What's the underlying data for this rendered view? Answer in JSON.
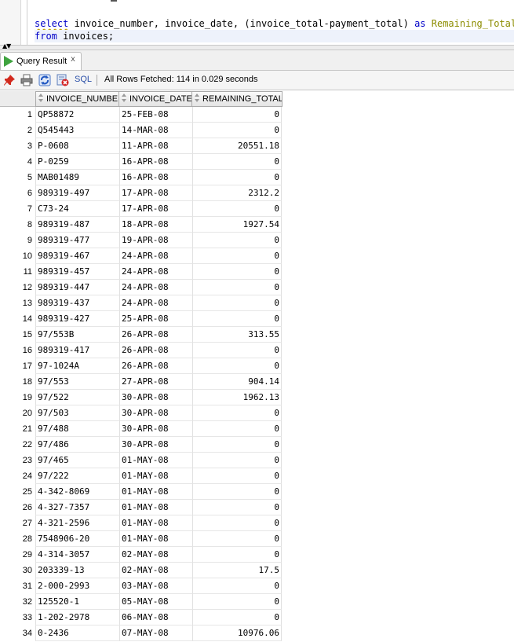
{
  "editor": {
    "line1": {
      "kw_select": "select",
      "columns": " invoice_number, invoice_date, (invoice_total-payment_total) ",
      "kw_as": "as",
      "alias": " Remaining_Total"
    },
    "line2": {
      "kw_from": "from",
      "table": " invoices;"
    }
  },
  "result_tab": {
    "label": "Query Result",
    "close": "x"
  },
  "toolbar": {
    "icons": [
      "pin-icon",
      "print-icon",
      "refresh-icon",
      "cancel-icon"
    ],
    "sql_label": "SQL",
    "status": "All Rows Fetched: 114 in 0.029 seconds"
  },
  "grid": {
    "columns": [
      "INVOICE_NUMBER",
      "INVOICE_DATE",
      "REMAINING_TOTAL"
    ],
    "rows": [
      {
        "n": "1",
        "invoice_number": "QP58872",
        "invoice_date": "25-FEB-08",
        "remaining_total": "0"
      },
      {
        "n": "2",
        "invoice_number": "Q545443",
        "invoice_date": "14-MAR-08",
        "remaining_total": "0"
      },
      {
        "n": "3",
        "invoice_number": "P-0608",
        "invoice_date": "11-APR-08",
        "remaining_total": "20551.18"
      },
      {
        "n": "4",
        "invoice_number": "P-0259",
        "invoice_date": "16-APR-08",
        "remaining_total": "0"
      },
      {
        "n": "5",
        "invoice_number": "MAB01489",
        "invoice_date": "16-APR-08",
        "remaining_total": "0"
      },
      {
        "n": "6",
        "invoice_number": "989319-497",
        "invoice_date": "17-APR-08",
        "remaining_total": "2312.2"
      },
      {
        "n": "7",
        "invoice_number": "C73-24",
        "invoice_date": "17-APR-08",
        "remaining_total": "0"
      },
      {
        "n": "8",
        "invoice_number": "989319-487",
        "invoice_date": "18-APR-08",
        "remaining_total": "1927.54"
      },
      {
        "n": "9",
        "invoice_number": "989319-477",
        "invoice_date": "19-APR-08",
        "remaining_total": "0"
      },
      {
        "n": "10",
        "invoice_number": "989319-467",
        "invoice_date": "24-APR-08",
        "remaining_total": "0"
      },
      {
        "n": "11",
        "invoice_number": "989319-457",
        "invoice_date": "24-APR-08",
        "remaining_total": "0"
      },
      {
        "n": "12",
        "invoice_number": "989319-447",
        "invoice_date": "24-APR-08",
        "remaining_total": "0"
      },
      {
        "n": "13",
        "invoice_number": "989319-437",
        "invoice_date": "24-APR-08",
        "remaining_total": "0"
      },
      {
        "n": "14",
        "invoice_number": "989319-427",
        "invoice_date": "25-APR-08",
        "remaining_total": "0"
      },
      {
        "n": "15",
        "invoice_number": "97/553B",
        "invoice_date": "26-APR-08",
        "remaining_total": "313.55"
      },
      {
        "n": "16",
        "invoice_number": "989319-417",
        "invoice_date": "26-APR-08",
        "remaining_total": "0"
      },
      {
        "n": "17",
        "invoice_number": "97-1024A",
        "invoice_date": "26-APR-08",
        "remaining_total": "0"
      },
      {
        "n": "18",
        "invoice_number": "97/553",
        "invoice_date": "27-APR-08",
        "remaining_total": "904.14"
      },
      {
        "n": "19",
        "invoice_number": "97/522",
        "invoice_date": "30-APR-08",
        "remaining_total": "1962.13"
      },
      {
        "n": "20",
        "invoice_number": "97/503",
        "invoice_date": "30-APR-08",
        "remaining_total": "0"
      },
      {
        "n": "21",
        "invoice_number": "97/488",
        "invoice_date": "30-APR-08",
        "remaining_total": "0"
      },
      {
        "n": "22",
        "invoice_number": "97/486",
        "invoice_date": "30-APR-08",
        "remaining_total": "0"
      },
      {
        "n": "23",
        "invoice_number": "97/465",
        "invoice_date": "01-MAY-08",
        "remaining_total": "0"
      },
      {
        "n": "24",
        "invoice_number": "97/222",
        "invoice_date": "01-MAY-08",
        "remaining_total": "0"
      },
      {
        "n": "25",
        "invoice_number": "4-342-8069",
        "invoice_date": "01-MAY-08",
        "remaining_total": "0"
      },
      {
        "n": "26",
        "invoice_number": "4-327-7357",
        "invoice_date": "01-MAY-08",
        "remaining_total": "0"
      },
      {
        "n": "27",
        "invoice_number": "4-321-2596",
        "invoice_date": "01-MAY-08",
        "remaining_total": "0"
      },
      {
        "n": "28",
        "invoice_number": "7548906-20",
        "invoice_date": "01-MAY-08",
        "remaining_total": "0"
      },
      {
        "n": "29",
        "invoice_number": "4-314-3057",
        "invoice_date": "02-MAY-08",
        "remaining_total": "0"
      },
      {
        "n": "30",
        "invoice_number": "203339-13",
        "invoice_date": "02-MAY-08",
        "remaining_total": "17.5"
      },
      {
        "n": "31",
        "invoice_number": "2-000-2993",
        "invoice_date": "03-MAY-08",
        "remaining_total": "0"
      },
      {
        "n": "32",
        "invoice_number": "125520-1",
        "invoice_date": "05-MAY-08",
        "remaining_total": "0"
      },
      {
        "n": "33",
        "invoice_number": "1-202-2978",
        "invoice_date": "06-MAY-08",
        "remaining_total": "0"
      },
      {
        "n": "34",
        "invoice_number": "0-2436",
        "invoice_date": "07-MAY-08",
        "remaining_total": "10976.06"
      }
    ]
  }
}
